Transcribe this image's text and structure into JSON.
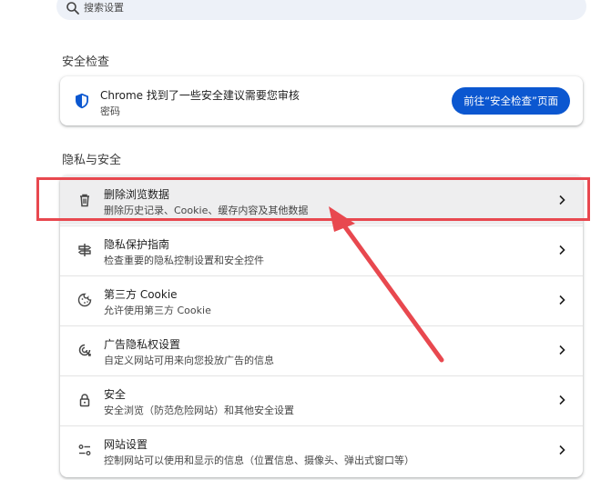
{
  "search": {
    "placeholder": "搜索设置"
  },
  "safety_check": {
    "section_title": "安全检查",
    "title": "Chrome 找到了一些安全建议需要您审核",
    "subtitle": "密码",
    "button_label": "前往“安全检查”页面"
  },
  "privacy": {
    "section_title": "隐私与安全",
    "items": [
      {
        "title": "删除浏览数据",
        "subtitle": "删除历史记录、Cookie、缓存内容及其他数据",
        "icon": "trash-icon"
      },
      {
        "title": "隐私保护指南",
        "subtitle": "检查重要的隐私控制设置和安全控件",
        "icon": "privacy-guide-icon"
      },
      {
        "title": "第三方 Cookie",
        "subtitle": "允许使用第三方 Cookie",
        "icon": "cookie-icon"
      },
      {
        "title": "广告隐私权设置",
        "subtitle": "自定义网站可用来向您投放广告的信息",
        "icon": "ad-privacy-icon"
      },
      {
        "title": "安全",
        "subtitle": "安全浏览（防范危险网站）和其他安全设置",
        "icon": "lock-icon"
      },
      {
        "title": "网站设置",
        "subtitle": "控制网站可以使用和显示的信息（位置信息、摄像头、弹出式窗口等）",
        "icon": "site-settings-icon"
      }
    ]
  },
  "colors": {
    "accent": "#0b57d0",
    "annotation": "#e8484f",
    "search_bg": "#edf1f8"
  }
}
